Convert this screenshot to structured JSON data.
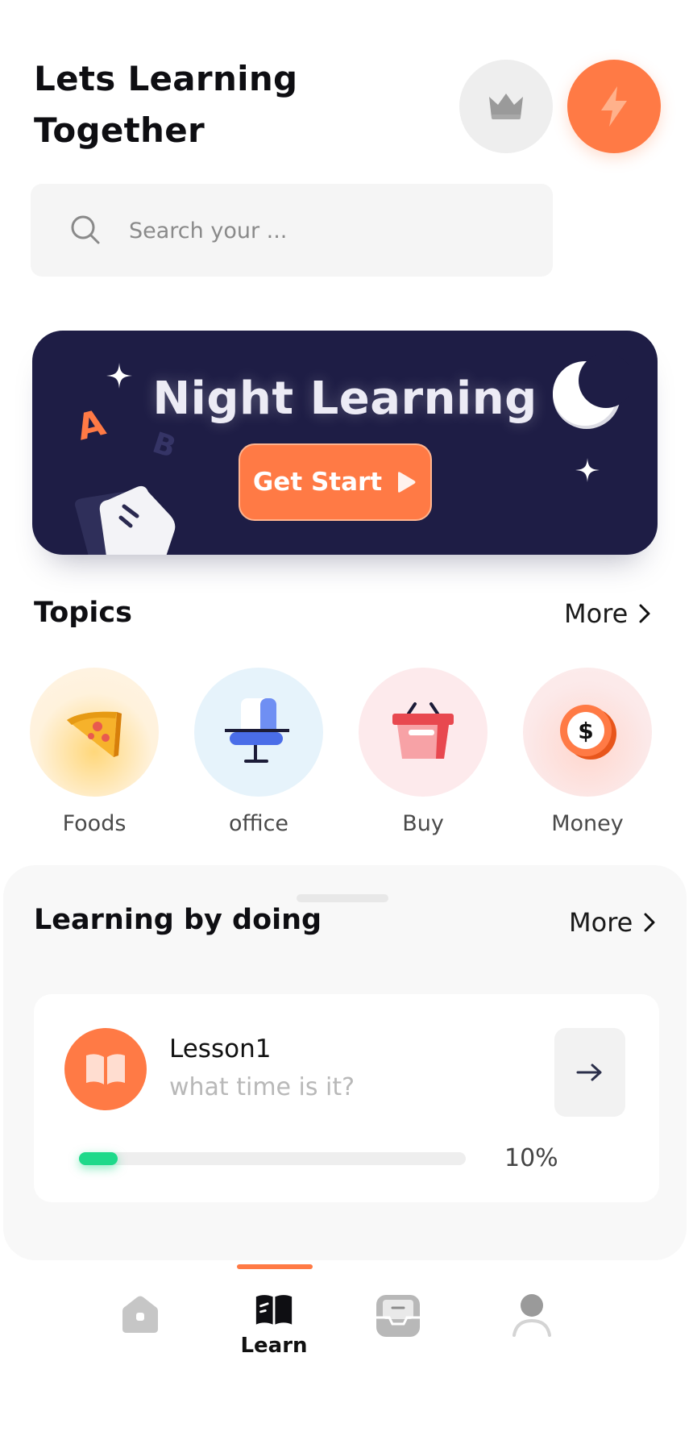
{
  "header": {
    "title_line1": "Lets Learning",
    "title_line2": "Together"
  },
  "search": {
    "placeholder": "Search your ..."
  },
  "banner": {
    "title": "Night Learning",
    "button_label": "Get Start",
    "letters": [
      "A",
      "B"
    ]
  },
  "topics": {
    "title": "Topics",
    "more_label": "More",
    "items": [
      {
        "label": "Foods",
        "icon": "pizza-icon"
      },
      {
        "label": "office",
        "icon": "office-chair-icon"
      },
      {
        "label": "Buy",
        "icon": "basket-icon"
      },
      {
        "label": "Money",
        "icon": "coin-icon"
      }
    ]
  },
  "learning": {
    "title": "Learning by doing",
    "more_label": "More",
    "lesson": {
      "title": "Lesson1",
      "subtitle": "what time is it?",
      "progress_text": "10%",
      "progress_value": 0.1
    }
  },
  "nav": {
    "items": [
      {
        "name": "home",
        "icon": "home-icon"
      },
      {
        "name": "learn",
        "icon": "book-icon",
        "label": "Learn",
        "active": true
      },
      {
        "name": "inbox",
        "icon": "inbox-icon"
      },
      {
        "name": "profile",
        "icon": "user-icon"
      }
    ]
  },
  "colors": {
    "accent": "#ff7a45",
    "banner_bg": "#1e1d45",
    "progress": "#1ed98a"
  }
}
